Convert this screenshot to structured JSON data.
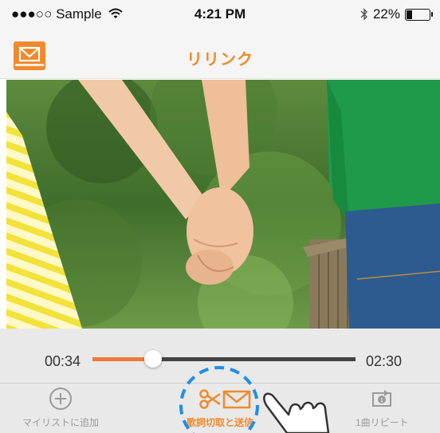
{
  "status_bar": {
    "carrier": "●●●○○ Sample",
    "time": "4:21 PM",
    "battery_percent": "22%",
    "battery_level": 0.22
  },
  "nav": {
    "title": "リリンク"
  },
  "player": {
    "current_time": "00:34",
    "total_time": "02:30",
    "progress": 0.23
  },
  "toolbar": {
    "add_label": "マイリストに追加",
    "cut_send_label": "歌詞切取と送信",
    "repeat_label": "1曲リピート"
  },
  "colors": {
    "accent": "#f08a2c",
    "progress": "#f07a3c",
    "highlight_ring": "#1e8fe6"
  },
  "icons": [
    "wifi-icon",
    "bluetooth-icon",
    "battery-icon",
    "mail-logo-icon",
    "plus-circle-icon",
    "scissors-icon",
    "envelope-icon",
    "repeat-one-icon",
    "hand-pointer-icon"
  ]
}
